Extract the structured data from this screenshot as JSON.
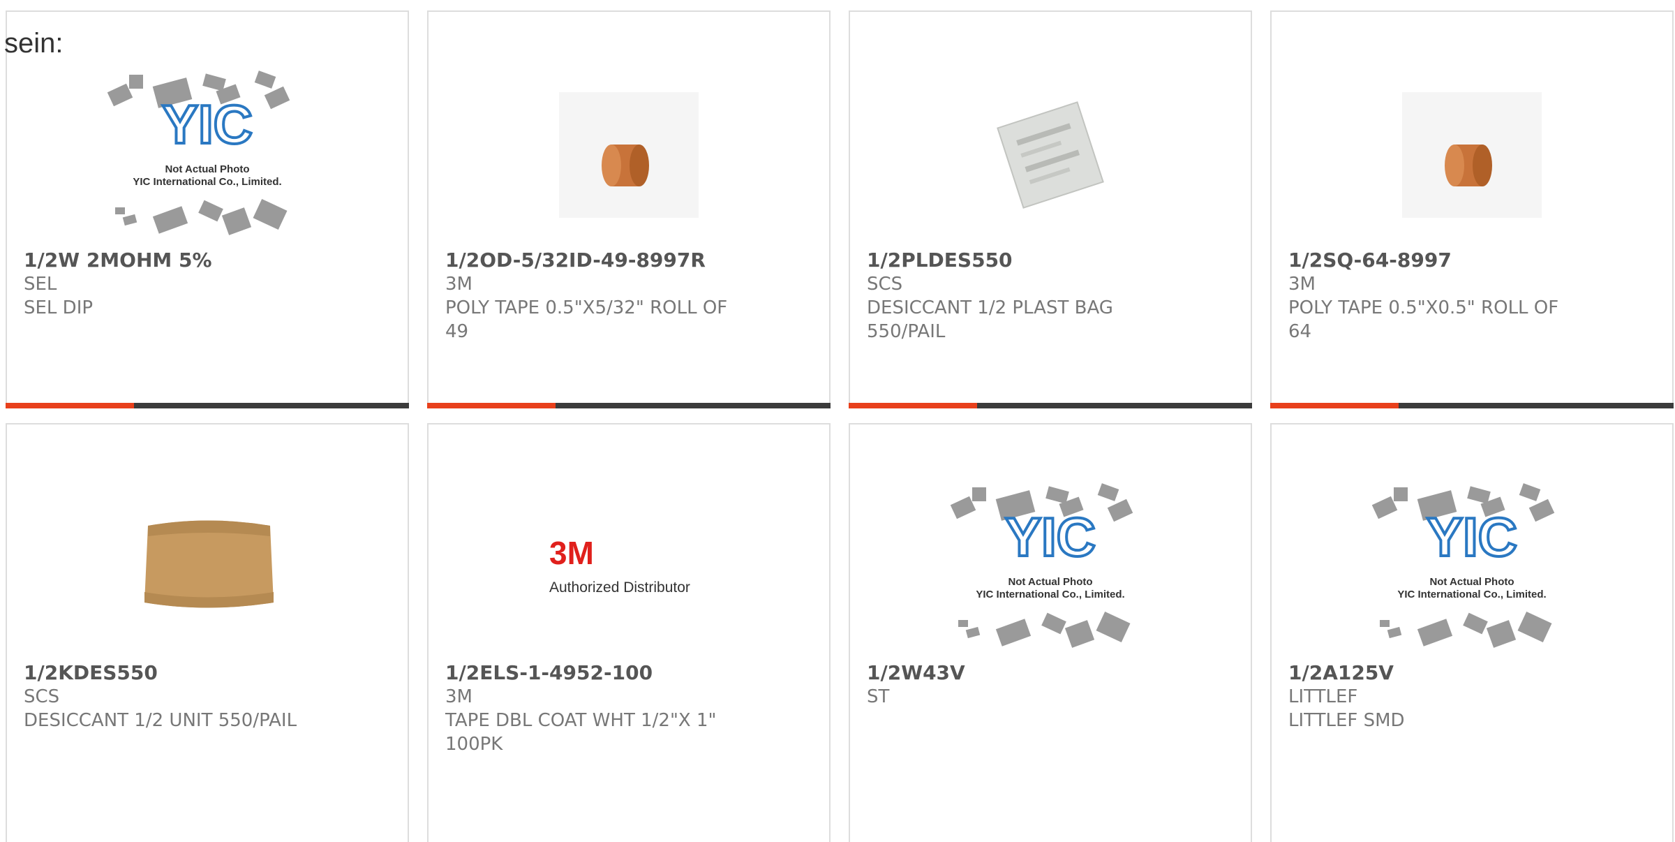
{
  "intro_text": "sein:",
  "placeholder": {
    "logo_text": "YIC",
    "line1": "Not Actual Photo",
    "line2": "YIC International Co., Limited."
  },
  "dist_logo": {
    "brand": "3M",
    "caption": "Authorized Distributor"
  },
  "products": [
    {
      "part": "1/2W 2MOHM 5%",
      "mfr": "SEL",
      "desc": "SEL DIP",
      "image": "placeholder-image"
    },
    {
      "part": "1/2OD-5/32ID-49-8997R",
      "mfr": "3M",
      "desc": "POLY TAPE 0.5\"X5/32\" ROLL OF 49",
      "image": "tape-roll-image"
    },
    {
      "part": "1/2PLDES550",
      "mfr": "SCS",
      "desc": "DESICCANT 1/2 PLAST BAG 550/PAIL",
      "image": "desiccant-bag-image"
    },
    {
      "part": "1/2SQ-64-8997",
      "mfr": "3M",
      "desc": "POLY TAPE 0.5\"X0.5\" ROLL OF 64",
      "image": "tape-roll-image"
    },
    {
      "part": "1/2KDES550",
      "mfr": "SCS",
      "desc": "DESICCANT 1/2 UNIT 550/PAIL",
      "image": "kraft-pouch-image"
    },
    {
      "part": "1/2ELS-1-4952-100",
      "mfr": "3M",
      "desc": "TAPE DBL COAT WHT 1/2\"X 1\" 100PK",
      "image": "3m-logo-image"
    },
    {
      "part": "1/2W43V",
      "mfr": "ST",
      "desc": "",
      "image": "placeholder-image"
    },
    {
      "part": "1/2A125V",
      "mfr": "LITTLEF",
      "desc": "LITTLEF SMD",
      "image": "placeholder-image"
    }
  ],
  "colors": {
    "accent": "#e8401c",
    "bar": "#3b3b3b",
    "border": "#dddddd",
    "logo_blue": "#2a78c2",
    "tape": "#c8733a"
  }
}
